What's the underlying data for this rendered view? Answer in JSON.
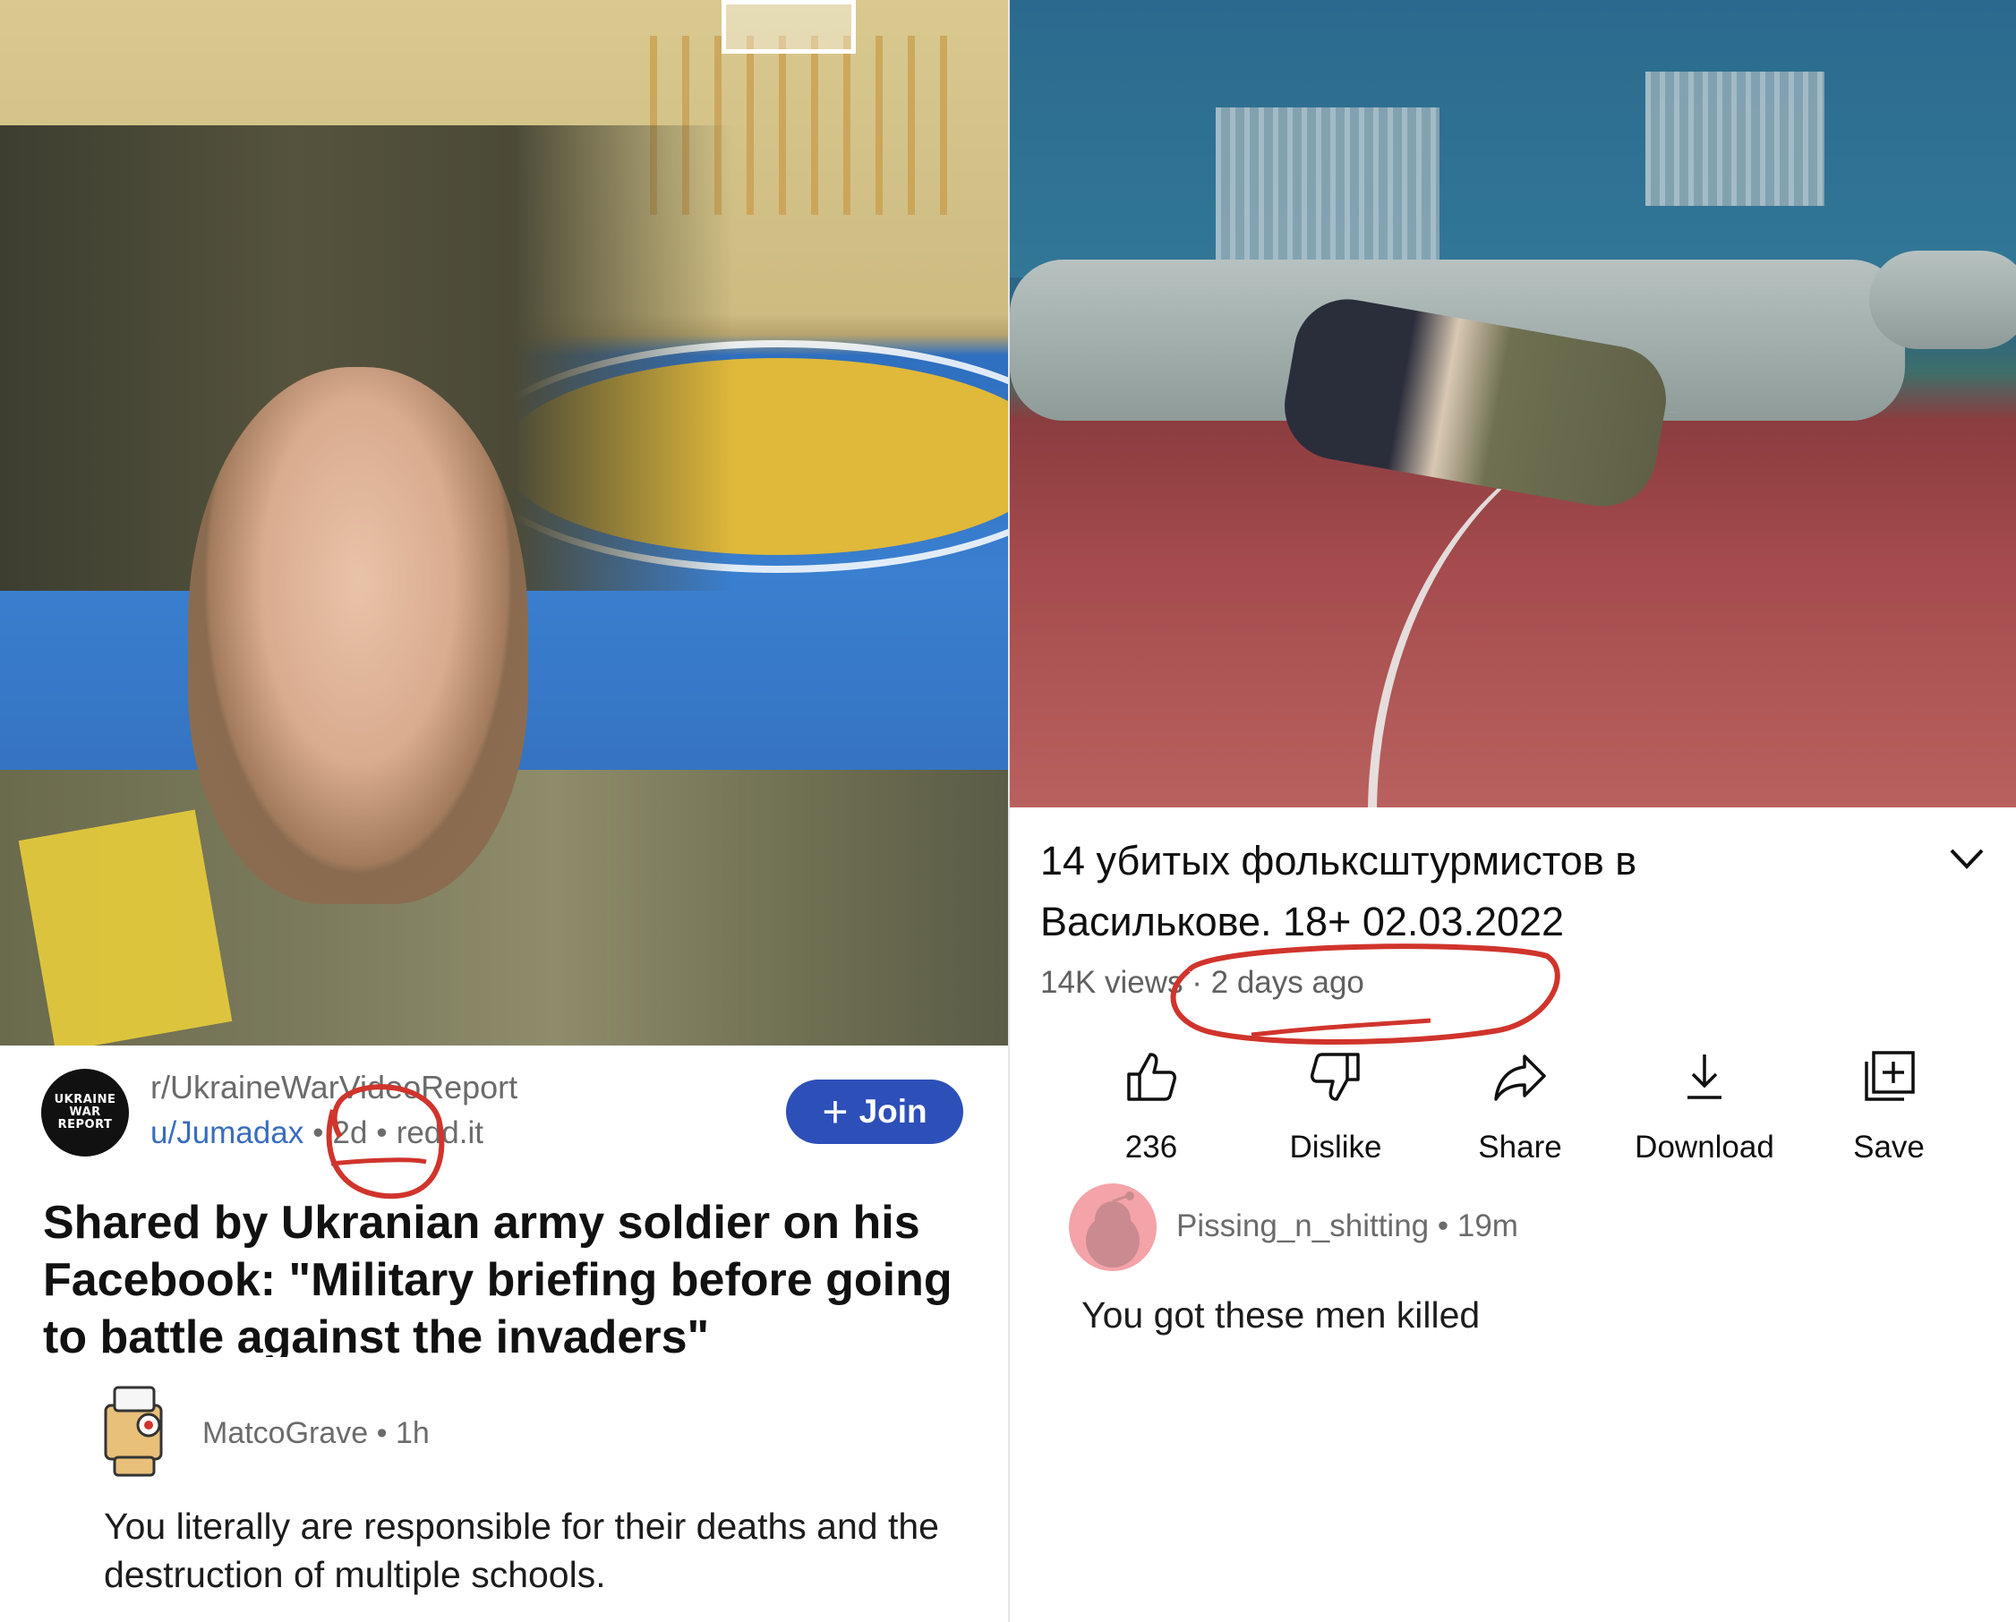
{
  "left_post": {
    "avatar_text_line1": "UKRAINE",
    "avatar_text_line2": "WAR REPORT",
    "subreddit": "r/UkraineWarVideoReport",
    "user": "u/Jumadax",
    "age": "2d",
    "separator": "•",
    "domain": "redd.it",
    "join_label": "Join",
    "title": "Shared by Ukranian army soldier on his Facebook: \"Military briefing before going to battle against the invaders\"",
    "comment": {
      "user": "MatcoGrave",
      "age": "1h",
      "text": "You literally are responsible for their deaths and the destruction of multiple schools."
    }
  },
  "right_video": {
    "title": "14 убитых фольксштурмистов в Василькове. 18+ 02.03.2022",
    "views": "14K views",
    "age": "2 days ago",
    "dot": "·",
    "actions": [
      {
        "label": "236",
        "icon": "thumbs-up-icon"
      },
      {
        "label": "Dislike",
        "icon": "thumbs-down-icon"
      },
      {
        "label": "Share",
        "icon": "share-icon"
      },
      {
        "label": "Download",
        "icon": "download-icon"
      },
      {
        "label": "Save",
        "icon": "save-playlist-icon"
      }
    ],
    "comment": {
      "user": "Pissing_n_shitting",
      "age": "19m",
      "text": "You got these men killed"
    }
  },
  "colors": {
    "join_button": "#2d4fb8",
    "link_blue": "#3a6dbf",
    "annotation_red": "#d0342c",
    "meta_gray": "#6b6b6b"
  }
}
